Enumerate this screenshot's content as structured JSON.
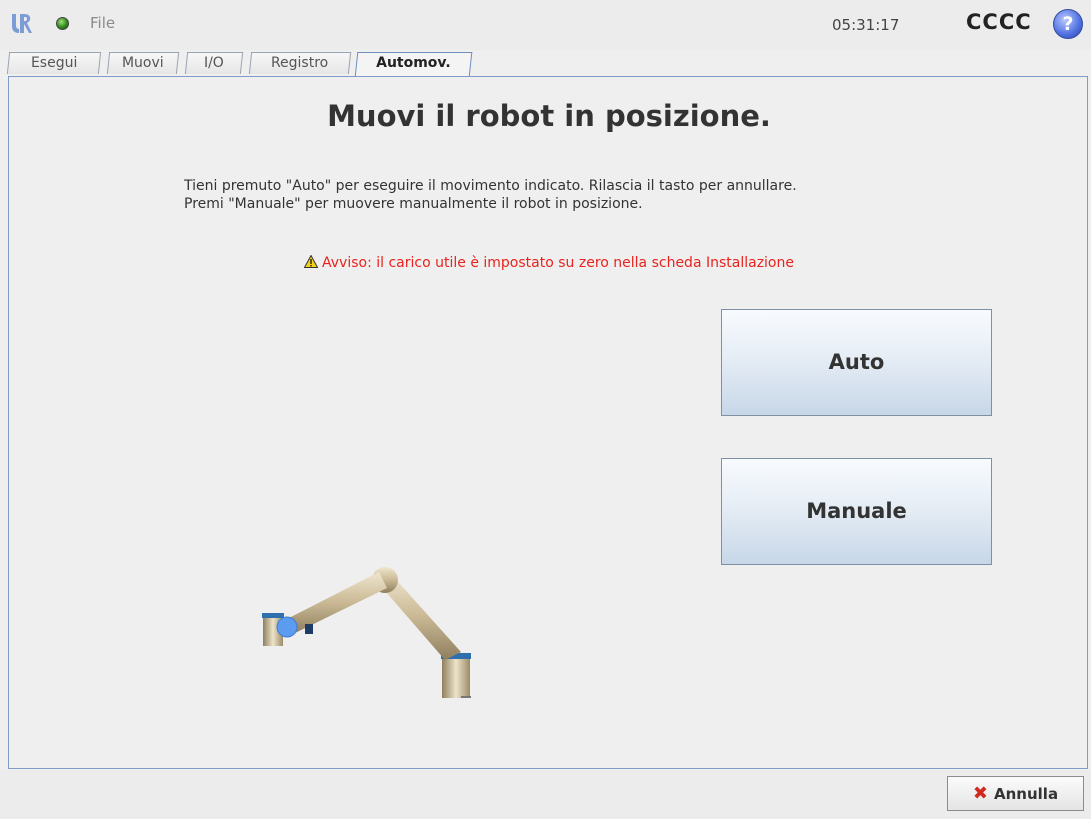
{
  "header": {
    "file_label": "File",
    "clock": "05:31:17",
    "robot_name": "CCCC",
    "help_symbol": "?"
  },
  "tabs": [
    {
      "label": "Esegui",
      "active": false
    },
    {
      "label": "Muovi",
      "active": false
    },
    {
      "label": "I/O",
      "active": false
    },
    {
      "label": "Registro",
      "active": false
    },
    {
      "label": "Automov.",
      "active": true
    }
  ],
  "main": {
    "title": "Muovi il robot in posizione.",
    "instruction_line1": "Tieni premuto \"Auto\" per eseguire il movimento indicato. Rilascia il tasto per annullare.",
    "instruction_line2": "Premi \"Manuale\" per muovere manualmente il robot in posizione.",
    "warning": "Avviso: il carico utile è impostato su zero nella scheda Installazione",
    "auto_label": "Auto",
    "manual_label": "Manuale"
  },
  "footer": {
    "cancel_label": "Annulla"
  },
  "colors": {
    "warning": "#e8231e",
    "panel_border": "#7f9cc9",
    "status_ok": "#2f8a1c"
  },
  "icons": {
    "logo": "ur-logo-icon",
    "status": "status-dot-icon",
    "help": "help-icon",
    "warning": "warning-triangle-icon",
    "cancel": "cancel-x-icon"
  }
}
